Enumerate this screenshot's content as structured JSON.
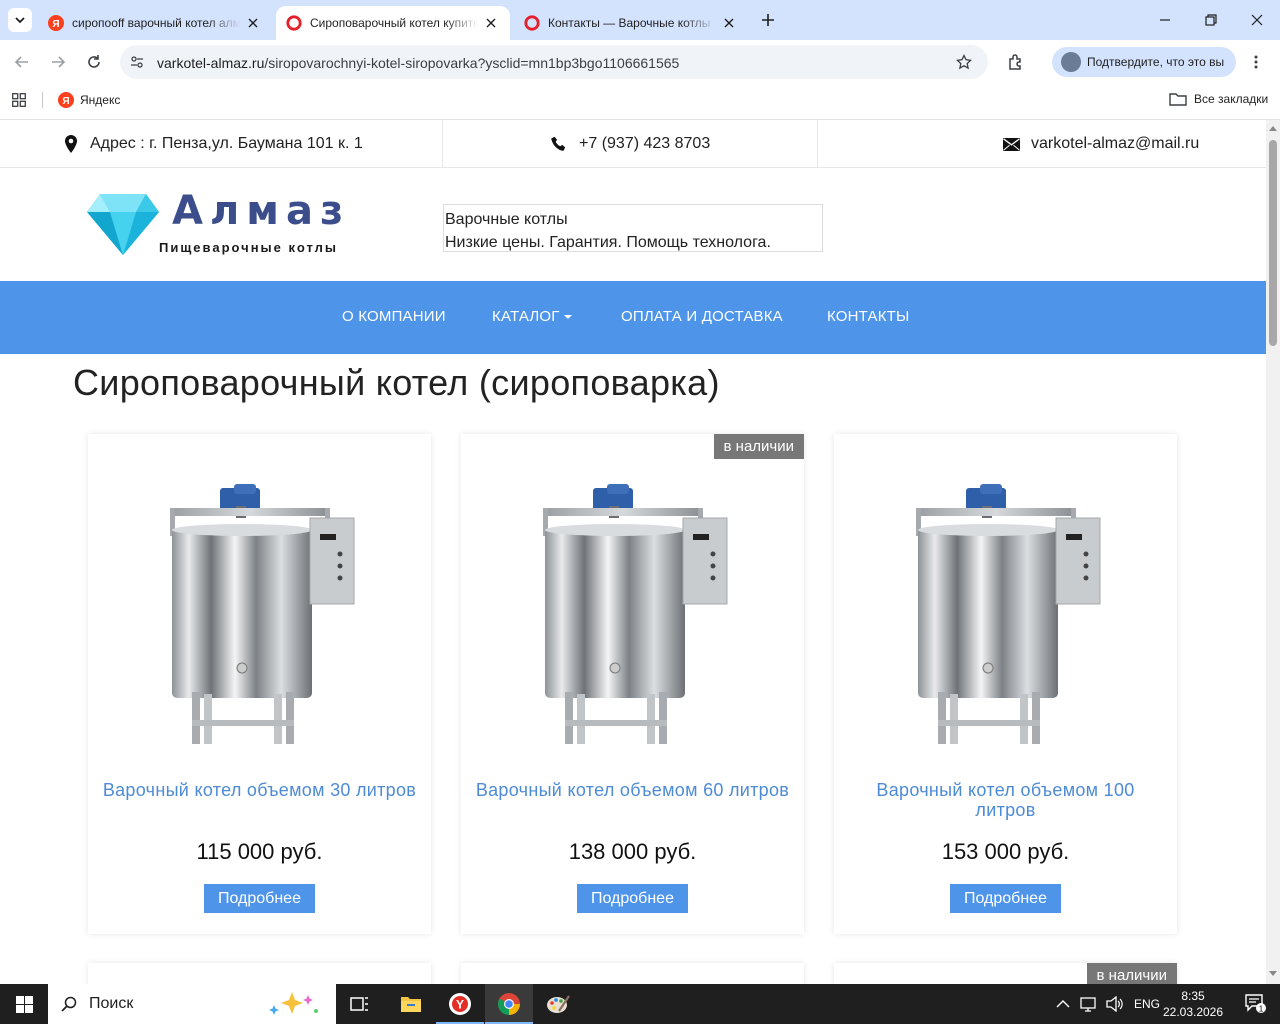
{
  "browser": {
    "tabs": [
      {
        "title": "сиропоoff варочный котел алмаз",
        "favicon": "yandex",
        "active": false
      },
      {
        "title": "Сироповарочный котел купить",
        "favicon": "opera",
        "active": true
      },
      {
        "title": "Контакты — Варочные котлы",
        "favicon": "opera",
        "active": false
      }
    ],
    "url_host": "varkotel-almaz.ru",
    "url_path": "/siropovarochnyi-kotel-siropovarka?ysclid=mn1bp3bgo1106661565",
    "profile_label": "Подтвердите, что это вы",
    "bookmarks": [
      {
        "label": "Яндекс"
      }
    ],
    "all_bookmarks_label": "Все закладки"
  },
  "site": {
    "address": "Адрес : г. Пенза,ул. Баумана 101 к. 1",
    "phone": "+7 (937) 423 8703",
    "email": "varkotel-almaz@mail.ru",
    "logo_name": "Алмаз",
    "logo_sub": "Пищеварочные  котлы",
    "tagline_line1": "Варочные котлы",
    "tagline_line2": "Низкие цены. Гарантия. Помощь технолога.",
    "nav": [
      {
        "label": "О компании"
      },
      {
        "label": "Каталог"
      },
      {
        "label": "Оплата и доставка"
      },
      {
        "label": "Контакты"
      }
    ],
    "page_title": "Сироповарочный котел (сироповарка)",
    "products": [
      {
        "name": "Варочный котел объемом 30 литров",
        "price": "115 000 руб.",
        "button": "Подробнее",
        "badge": ""
      },
      {
        "name": "Варочный котел объемом 60 литров",
        "price": "138 000 руб.",
        "button": "Подробнее",
        "badge": "в наличии"
      },
      {
        "name": "Варочный котел объемом 100 литров",
        "price": "153 000 руб.",
        "button": "Подробнее",
        "badge": ""
      }
    ],
    "next_row_badge": "в наличии",
    "colors": {
      "nav": "#4e95ea",
      "link": "#4e8bd6",
      "badge": "#777777"
    }
  },
  "taskbar": {
    "search_placeholder": "Поиск",
    "lang": "ENG",
    "time": "8:35",
    "date": "22.03.2026",
    "notifications": "1"
  }
}
